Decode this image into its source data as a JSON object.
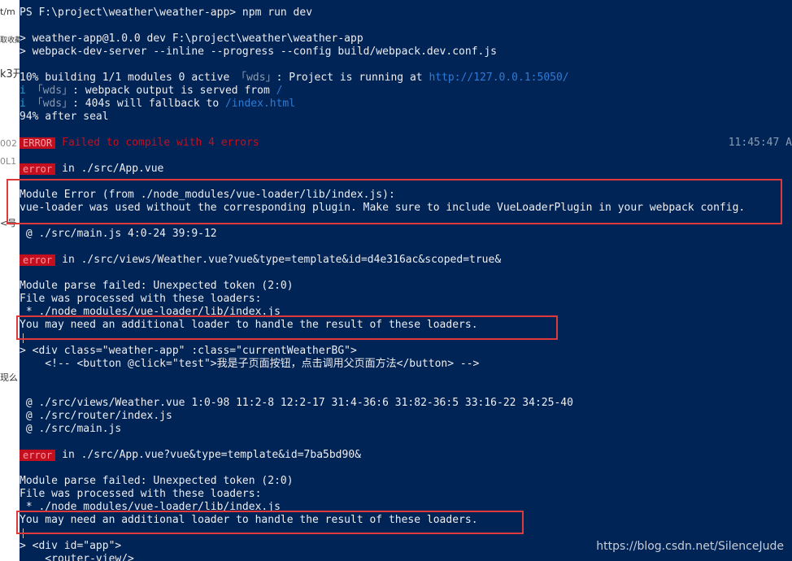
{
  "left_strip": {
    "fragments": [
      "t/m",
      "取收藏",
      "k3开",
      "002",
      "0L1",
      "<号",
      "现么"
    ]
  },
  "terminal": {
    "prompt": "PS F:\\project\\weather\\weather-app> npm run dev",
    "script_line1": "> weather-app@1.0.0 dev F:\\project\\weather\\weather-app",
    "script_line2": "> webpack-dev-server --inline --progress --config build/webpack.dev.conf.js",
    "progress_text": "10% building 1/1 modules 0 active ",
    "wds_tag": "「wds」",
    "running_text": ": Project is running at ",
    "running_url": "http://127.0.0.1:5050/",
    "info_i": "i",
    "served_text": ": webpack output is served from ",
    "served_path": "/",
    "fallback_text": ": 404s will fallback to ",
    "fallback_path": "/index.html",
    "after_seal": "94% after seal",
    "error_badge": "ERROR",
    "failed_text": "Failed to compile with 4 errors",
    "timestamp": "11:45:47 A",
    "err1_badge": "error",
    "err1_in": "in ./src/App.vue",
    "err1_msg1": "Module Error (from ./node_modules/vue-loader/lib/index.js):",
    "err1_msg2": "vue-loader was used without the corresponding plugin. Make sure to include VueLoaderPlugin in your webpack config.",
    "err1_at": " @ ./src/main.js 4:0-24 39:9-12",
    "err2_badge": "error",
    "err2_in": "in ./src/views/Weather.vue?vue&type=template&id=d4e316ac&scoped=true&",
    "err2_parse": "Module parse failed: Unexpected token (2:0)",
    "err2_processed": "File was processed with these loaders:",
    "err2_loader": " * ./node_modules/vue-loader/lib/index.js",
    "err2_need": "You may need an additional loader to handle the result of these loaders.",
    "err2_code1": "> <div class=\"weather-app\" :class=\"currentWeatherBG\">",
    "err2_code2": "    <!-- <button @click=\"test\">我是子页面按钮，点击调用父页面方法</button> -->",
    "err2_at1": " @ ./src/views/Weather.vue 1:0-98 11:2-8 12:2-17 31:4-36:6 31:82-36:5 33:16-22 34:25-40",
    "err2_at2": " @ ./src/router/index.js",
    "err2_at3": " @ ./src/main.js",
    "err3_badge": "error",
    "err3_in": "in ./src/App.vue?vue&type=template&id=7ba5bd90&",
    "err3_parse": "Module parse failed: Unexpected token (2:0)",
    "err3_processed": "File was processed with these loaders:",
    "err3_loader": " * ./node_modules/vue-loader/lib/index.js",
    "err3_need": "You may need an additional loader to handle the result of these loaders.",
    "err3_code1": "> <div id=\"app\">",
    "err3_code2": "    <router-view/>"
  },
  "watermark": "https://blog.csdn.net/SilenceJude",
  "colors": {
    "terminal_bg": "#012456",
    "text": "#eeedf0",
    "error_red": "#c50f1f",
    "highlight_border": "#e0393b",
    "link_blue": "#2e7bd4"
  }
}
